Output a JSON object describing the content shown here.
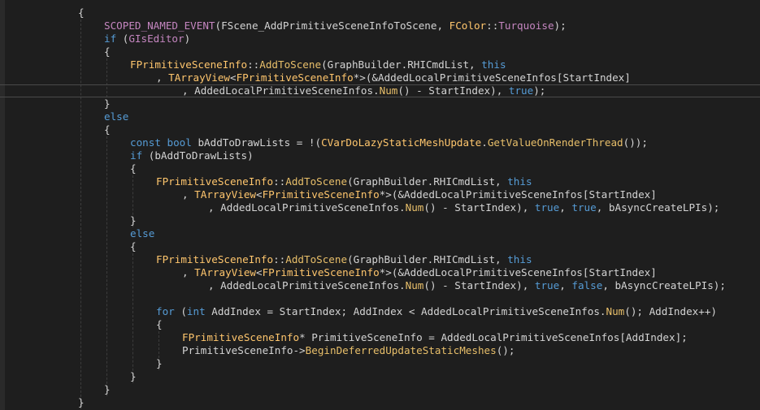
{
  "editor": {
    "theme": {
      "background": "#1e1e1e",
      "keyword": "#569cd6",
      "macro": "#c586c0",
      "type": "#ffc66d",
      "function": "#e8bf6a",
      "text": "#d4d4d4"
    },
    "lines": [
      {
        "indent": 11,
        "tokens": [
          [
            "{",
            "punct"
          ]
        ]
      },
      {
        "indent": 15,
        "tokens": [
          [
            "SCOPED_NAMED_EVENT",
            "macro"
          ],
          [
            "(FScene_AddPrimitiveSceneInfoToScene, ",
            "txt"
          ],
          [
            "FColor",
            "type"
          ],
          [
            "::",
            "punct"
          ],
          [
            "Turquoise",
            "macro"
          ],
          [
            ");",
            "punct"
          ]
        ]
      },
      {
        "indent": 15,
        "tokens": [
          [
            "if",
            "kw"
          ],
          [
            " (",
            "punct"
          ],
          [
            "GIsEditor",
            "macro"
          ],
          [
            ")",
            "punct"
          ]
        ]
      },
      {
        "indent": 15,
        "tokens": [
          [
            "{",
            "punct"
          ]
        ]
      },
      {
        "indent": 19,
        "tokens": [
          [
            "FPrimitiveSceneInfo",
            "type"
          ],
          [
            "::",
            "punct"
          ],
          [
            "AddToScene",
            "func"
          ],
          [
            "(GraphBuilder.RHICmdList, ",
            "txt"
          ],
          [
            "this",
            "kw"
          ]
        ]
      },
      {
        "indent": 23,
        "tokens": [
          [
            ", ",
            "punct"
          ],
          [
            "TArrayView",
            "type"
          ],
          [
            "<",
            "punct"
          ],
          [
            "FPrimitiveSceneInfo",
            "type"
          ],
          [
            "*>(&AddedLocalPrimitiveSceneInfos[StartIndex]",
            "txt"
          ]
        ]
      },
      {
        "indent": 27,
        "tokens": [
          [
            ", AddedLocalPrimitiveSceneInfos.",
            "txt"
          ],
          [
            "Num",
            "func"
          ],
          [
            "() - StartIndex), ",
            "txt"
          ],
          [
            "true",
            "kw"
          ],
          [
            ");",
            "punct"
          ]
        ],
        "current": true
      },
      {
        "indent": 15,
        "tokens": [
          [
            "}",
            "punct"
          ]
        ]
      },
      {
        "indent": 15,
        "tokens": [
          [
            "else",
            "kw"
          ]
        ]
      },
      {
        "indent": 15,
        "tokens": [
          [
            "{",
            "punct"
          ]
        ]
      },
      {
        "indent": 19,
        "tokens": [
          [
            "const",
            "kw"
          ],
          [
            " ",
            "txt"
          ],
          [
            "bool",
            "kw"
          ],
          [
            " bAddToDrawLists = !(",
            "txt"
          ],
          [
            "CVarDoLazyStaticMeshUpdate",
            "type"
          ],
          [
            ".",
            "punct"
          ],
          [
            "GetValueOnRenderThread",
            "func"
          ],
          [
            "());",
            "punct"
          ]
        ]
      },
      {
        "indent": 19,
        "tokens": [
          [
            "if",
            "kw"
          ],
          [
            " (bAddToDrawLists)",
            "txt"
          ]
        ]
      },
      {
        "indent": 19,
        "tokens": [
          [
            "{",
            "punct"
          ]
        ]
      },
      {
        "indent": 23,
        "tokens": [
          [
            "FPrimitiveSceneInfo",
            "type"
          ],
          [
            "::",
            "punct"
          ],
          [
            "AddToScene",
            "func"
          ],
          [
            "(GraphBuilder.RHICmdList, ",
            "txt"
          ],
          [
            "this",
            "kw"
          ]
        ]
      },
      {
        "indent": 27,
        "tokens": [
          [
            ", ",
            "punct"
          ],
          [
            "TArrayView",
            "type"
          ],
          [
            "<",
            "punct"
          ],
          [
            "FPrimitiveSceneInfo",
            "type"
          ],
          [
            "*>(&AddedLocalPrimitiveSceneInfos[StartIndex]",
            "txt"
          ]
        ]
      },
      {
        "indent": 31,
        "tokens": [
          [
            ", AddedLocalPrimitiveSceneInfos.",
            "txt"
          ],
          [
            "Num",
            "func"
          ],
          [
            "() - StartIndex), ",
            "txt"
          ],
          [
            "true",
            "kw"
          ],
          [
            ", ",
            "txt"
          ],
          [
            "true",
            "kw"
          ],
          [
            ", bAsyncCreateLPIs);",
            "txt"
          ]
        ]
      },
      {
        "indent": 19,
        "tokens": [
          [
            "}",
            "punct"
          ]
        ]
      },
      {
        "indent": 19,
        "tokens": [
          [
            "else",
            "kw"
          ]
        ]
      },
      {
        "indent": 19,
        "tokens": [
          [
            "{",
            "punct"
          ]
        ]
      },
      {
        "indent": 23,
        "tokens": [
          [
            "FPrimitiveSceneInfo",
            "type"
          ],
          [
            "::",
            "punct"
          ],
          [
            "AddToScene",
            "func"
          ],
          [
            "(GraphBuilder.RHICmdList, ",
            "txt"
          ],
          [
            "this",
            "kw"
          ]
        ]
      },
      {
        "indent": 27,
        "tokens": [
          [
            ", ",
            "punct"
          ],
          [
            "TArrayView",
            "type"
          ],
          [
            "<",
            "punct"
          ],
          [
            "FPrimitiveSceneInfo",
            "type"
          ],
          [
            "*>(&AddedLocalPrimitiveSceneInfos[StartIndex]",
            "txt"
          ]
        ]
      },
      {
        "indent": 31,
        "tokens": [
          [
            ", AddedLocalPrimitiveSceneInfos.",
            "txt"
          ],
          [
            "Num",
            "func"
          ],
          [
            "() - StartIndex), ",
            "txt"
          ],
          [
            "true",
            "kw"
          ],
          [
            ", ",
            "txt"
          ],
          [
            "false",
            "kw"
          ],
          [
            ", bAsyncCreateLPIs);",
            "txt"
          ]
        ]
      },
      {
        "indent": 0,
        "tokens": []
      },
      {
        "indent": 23,
        "tokens": [
          [
            "for",
            "kw"
          ],
          [
            " (",
            "punct"
          ],
          [
            "int",
            "kw"
          ],
          [
            " AddIndex = StartIndex; AddIndex < AddedLocalPrimitiveSceneInfos.",
            "txt"
          ],
          [
            "Num",
            "func"
          ],
          [
            "(); AddIndex++)",
            "txt"
          ]
        ]
      },
      {
        "indent": 23,
        "tokens": [
          [
            "{",
            "punct"
          ]
        ]
      },
      {
        "indent": 27,
        "tokens": [
          [
            "FPrimitiveSceneInfo",
            "type"
          ],
          [
            "* PrimitiveSceneInfo = AddedLocalPrimitiveSceneInfos[AddIndex];",
            "txt"
          ]
        ]
      },
      {
        "indent": 27,
        "tokens": [
          [
            "PrimitiveSceneInfo->",
            "txt"
          ],
          [
            "BeginDeferredUpdateStaticMeshes",
            "func"
          ],
          [
            "();",
            "punct"
          ]
        ]
      },
      {
        "indent": 23,
        "tokens": [
          [
            "}",
            "punct"
          ]
        ]
      },
      {
        "indent": 19,
        "tokens": [
          [
            "}",
            "punct"
          ]
        ]
      },
      {
        "indent": 15,
        "tokens": [
          [
            "}",
            "punct"
          ]
        ]
      },
      {
        "indent": 11,
        "tokens": [
          [
            "}",
            "punct"
          ]
        ]
      }
    ]
  }
}
